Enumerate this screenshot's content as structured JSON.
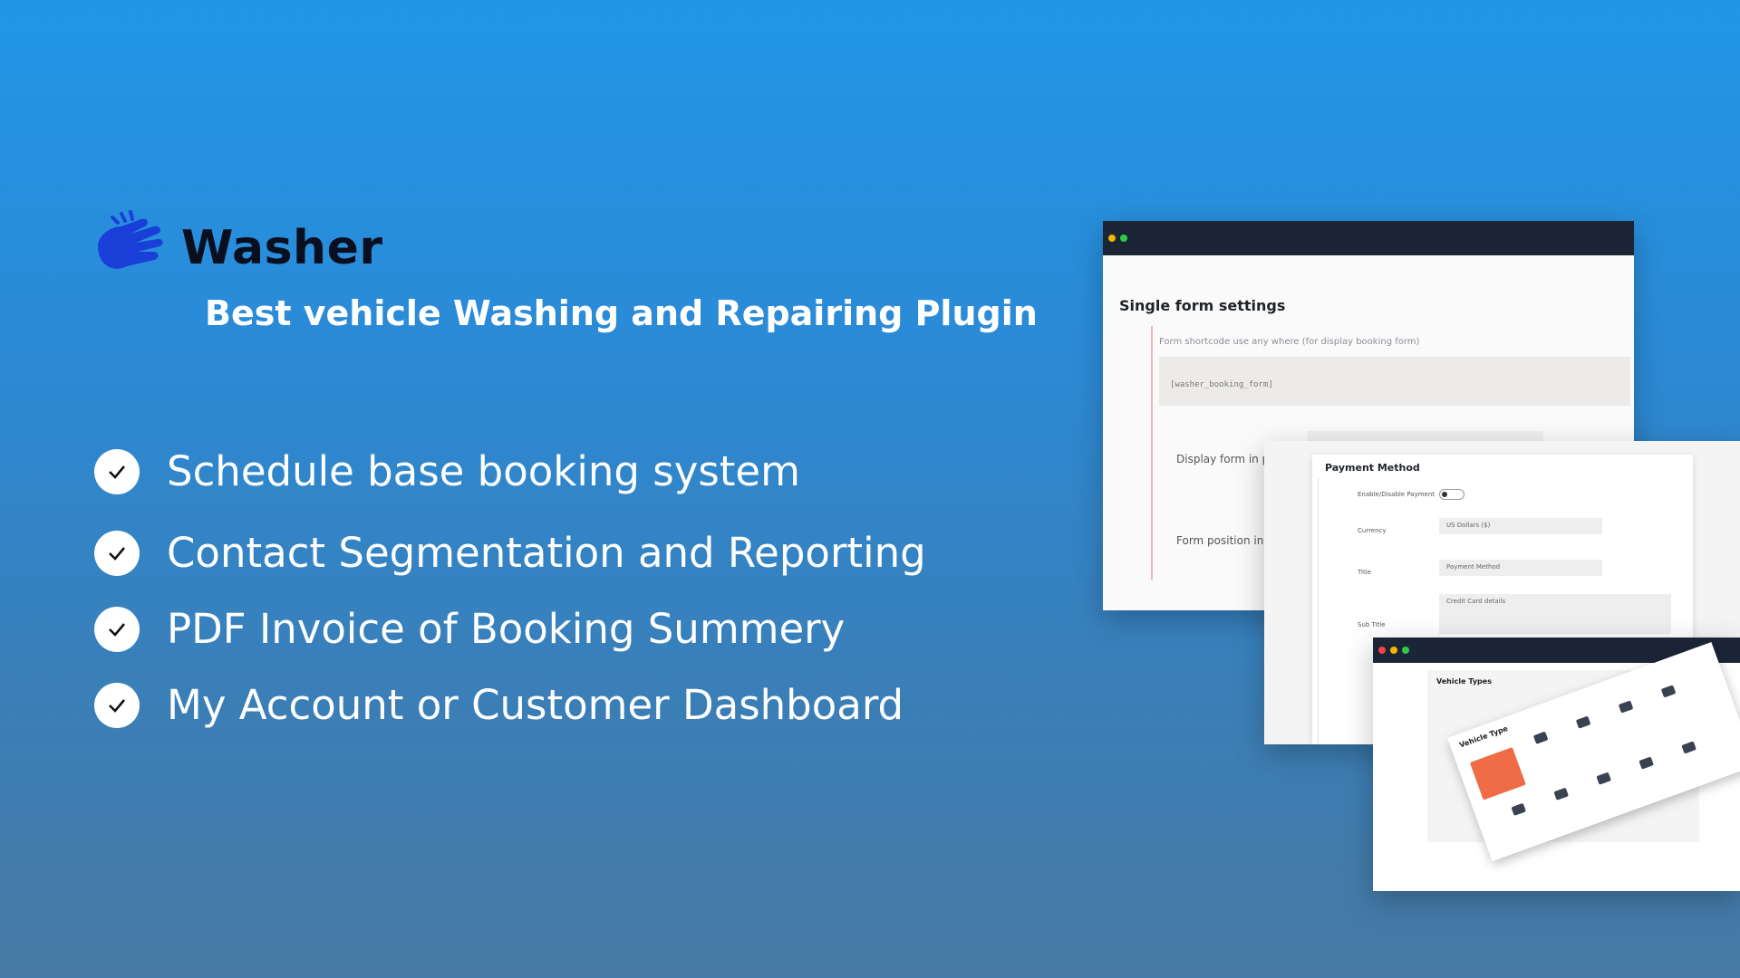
{
  "brand": {
    "name": "Washer",
    "logo_icon": "hand-wash-icon",
    "logo_color": "#1a3fd8"
  },
  "tagline": "Best vehicle Washing and Repairing Plugin",
  "features": [
    {
      "icon": "check-icon",
      "label": "Schedule base booking system"
    },
    {
      "icon": "check-icon",
      "label": "Contact Segmentation and Reporting"
    },
    {
      "icon": "check-icon",
      "label": "PDF Invoice of Booking Summery"
    },
    {
      "icon": "check-icon",
      "label": "My Account or Customer Dashboard"
    }
  ],
  "mockups": {
    "single_form": {
      "title": "Single form settings",
      "hint": "Form shortcode use any where (for display booking form)",
      "shortcode": "[washer_booking_form]",
      "label_display": "Display form in p",
      "label_position": "Form position in ("
    },
    "payment": {
      "title": "Payment Method",
      "toggle_label": "Enable/Disable Payment",
      "currency_label": "Currency",
      "currency_value": "US Dollars ($)",
      "title_label": "Title",
      "title_value": "Payment Method",
      "subtitle_label": "Sub Title",
      "subtitle_value": "Credit Card details"
    },
    "vehicle": {
      "title": "Vehicle Types",
      "card_title": "Vehicle Type"
    }
  },
  "colors": {
    "background_top": "#2196e6",
    "background_bottom": "#4779a3",
    "accent": "#ef6c46"
  }
}
